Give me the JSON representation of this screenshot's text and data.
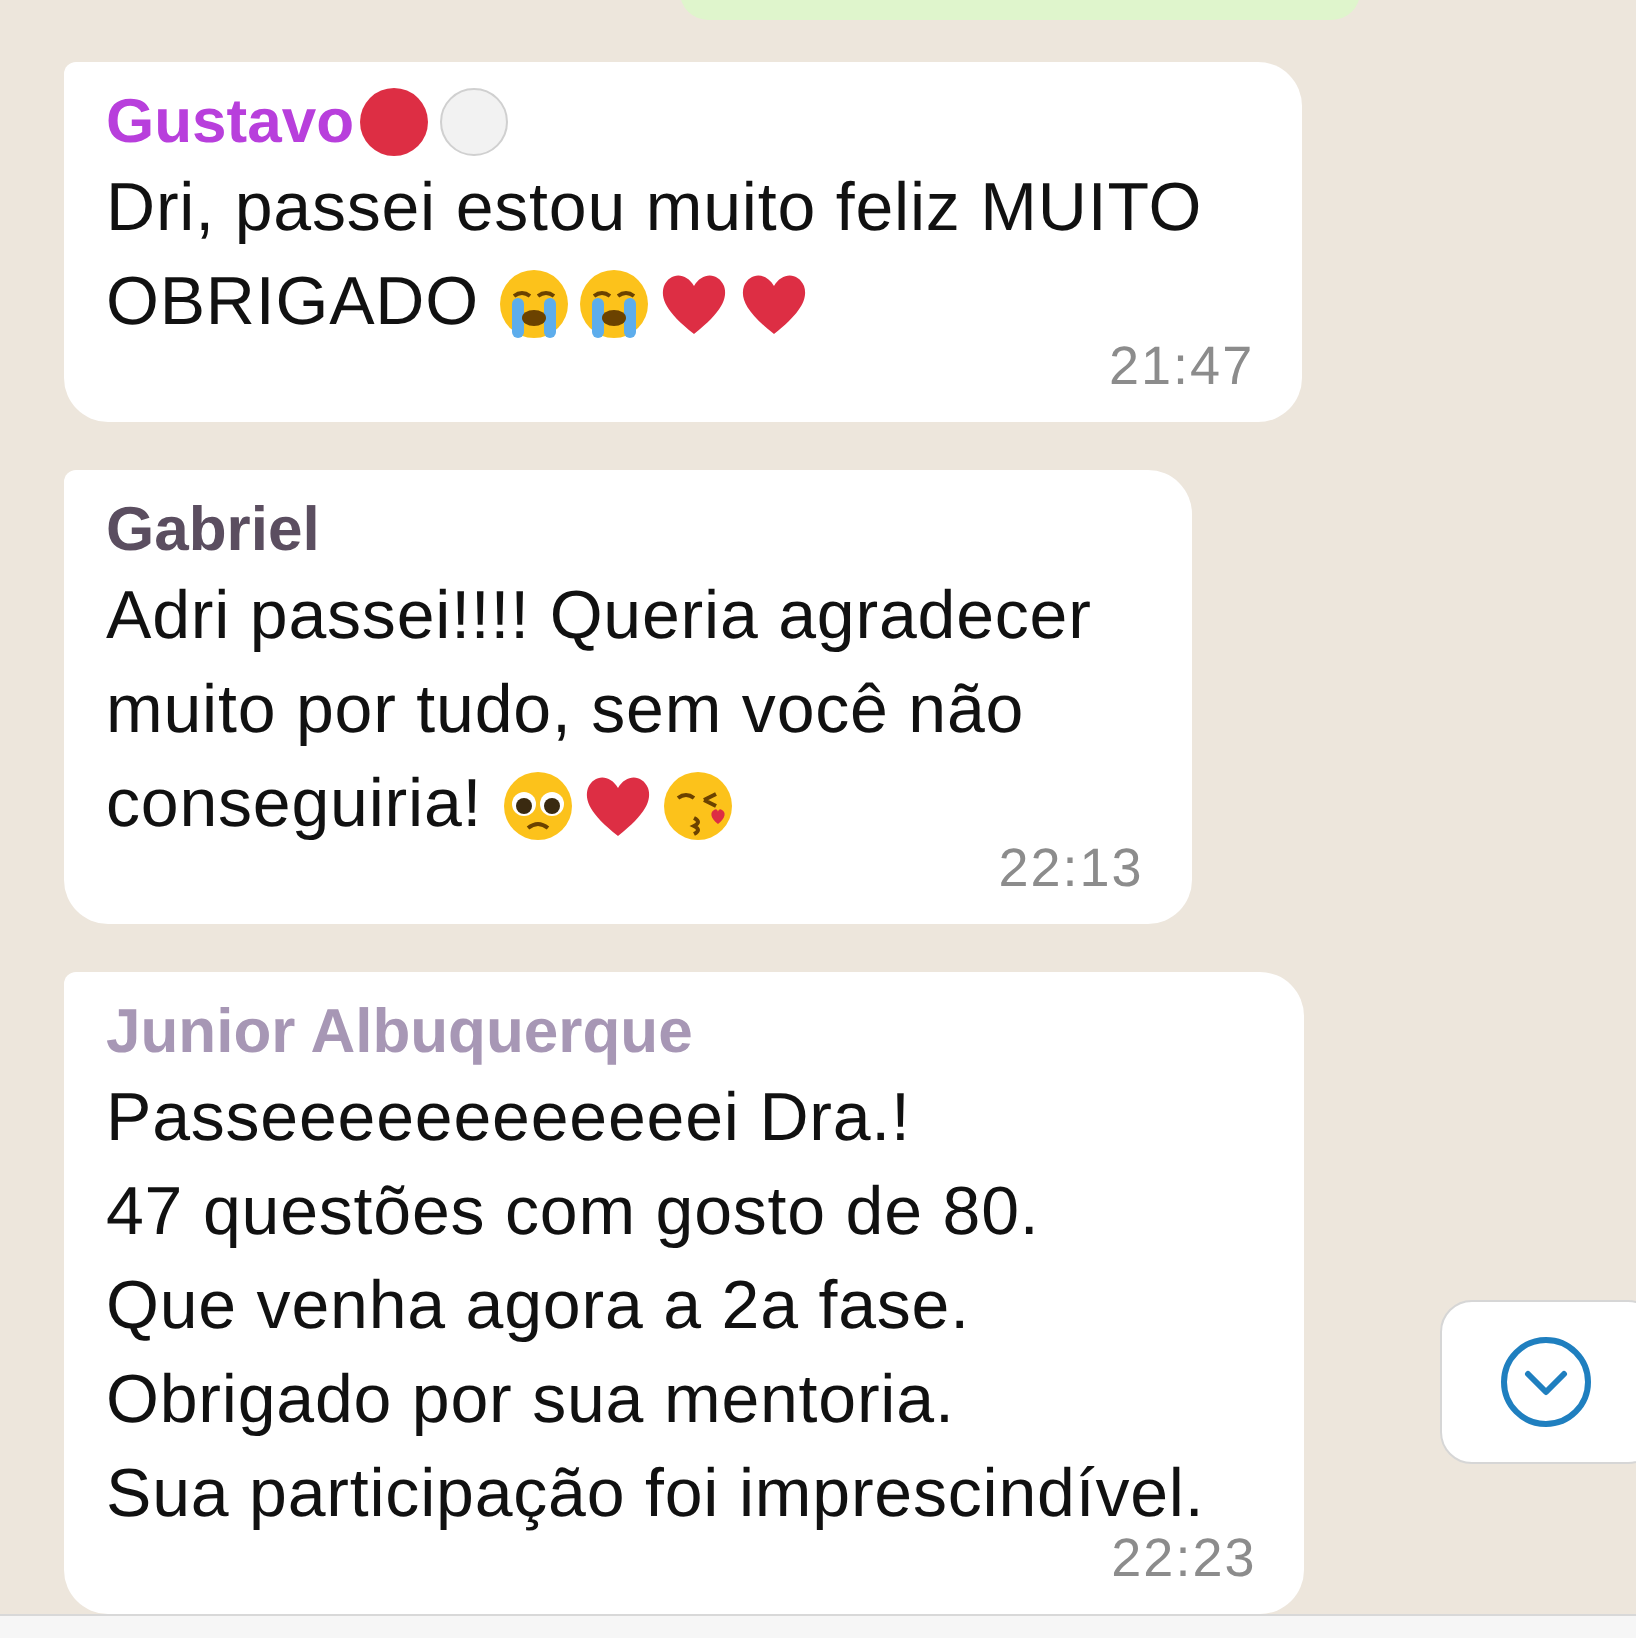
{
  "messages": [
    {
      "sender": "Gustavo",
      "color": "#b83fdc",
      "name_badges": [
        {
          "kind": "red-circle"
        },
        {
          "kind": "white-circle"
        }
      ],
      "lines": [
        "Dri, passei estou muito feliz MUITO",
        "OBRIGADO"
      ],
      "emojis": [
        {
          "kind": "sob"
        },
        {
          "kind": "sob"
        },
        {
          "kind": "heart"
        },
        {
          "kind": "heart"
        }
      ],
      "time": "21:47"
    },
    {
      "sender": "Gabriel",
      "color": "#5b4e60",
      "lines": [
        "Adri passei!!!! Queria agradecer",
        "muito por tudo, sem você não",
        "conseguiria!"
      ],
      "emojis": [
        {
          "kind": "pleading"
        },
        {
          "kind": "heart"
        },
        {
          "kind": "kiss"
        }
      ],
      "time": "22:13"
    },
    {
      "sender": "Junior Albuquerque",
      "color": "#a797b5",
      "lines": [
        "Passeeeeeeeeeeeei Dra.!",
        "47 questões com gosto de 80.",
        "Que venha agora a 2a fase.",
        "Obrigado por sua mentoria.",
        "Sua participação foi imprescindível."
      ],
      "time": "22:23"
    }
  ]
}
